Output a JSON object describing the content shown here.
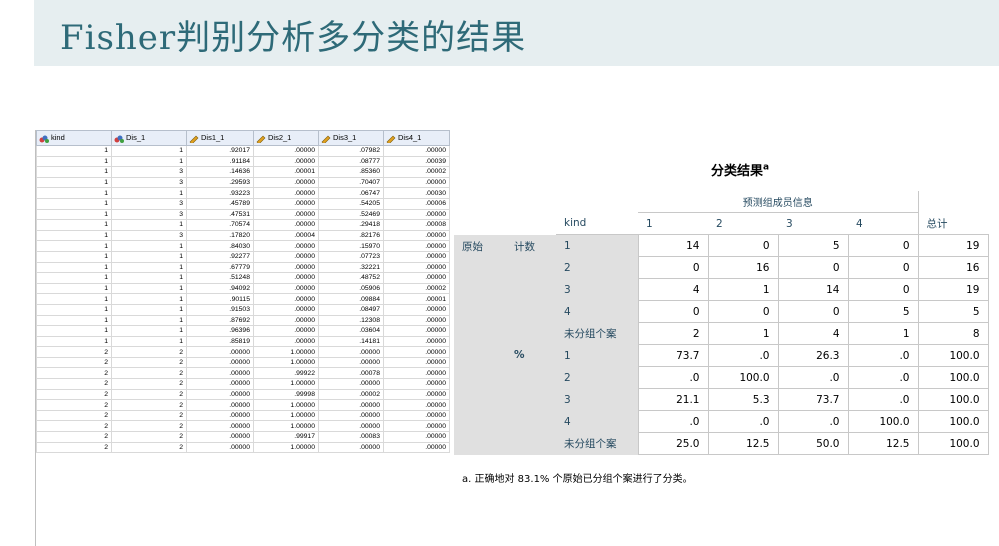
{
  "slide": {
    "title": "Fisher判别分析多分类的结果"
  },
  "grid": {
    "columns": [
      "kind",
      "Dis_1",
      "Dis1_1",
      "Dis2_1",
      "Dis3_1",
      "Dis4_1"
    ],
    "rows": [
      [
        "1",
        "1",
        ".92017",
        ".00000",
        ".07982",
        ".00000"
      ],
      [
        "1",
        "1",
        ".91184",
        ".00000",
        ".08777",
        ".00039"
      ],
      [
        "1",
        "3",
        ".14636",
        ".00001",
        ".85360",
        ".00002"
      ],
      [
        "1",
        "3",
        ".29593",
        ".00000",
        ".70407",
        ".00000"
      ],
      [
        "1",
        "1",
        ".93223",
        ".00000",
        ".06747",
        ".00030"
      ],
      [
        "1",
        "3",
        ".45789",
        ".00000",
        ".54205",
        ".00006"
      ],
      [
        "1",
        "3",
        ".47531",
        ".00000",
        ".52469",
        ".00000"
      ],
      [
        "1",
        "1",
        ".70574",
        ".00000",
        ".29418",
        ".00008"
      ],
      [
        "1",
        "3",
        ".17820",
        ".00004",
        ".82176",
        ".00000"
      ],
      [
        "1",
        "1",
        ".84030",
        ".00000",
        ".15970",
        ".00000"
      ],
      [
        "1",
        "1",
        ".92277",
        ".00000",
        ".07723",
        ".00000"
      ],
      [
        "1",
        "1",
        ".67779",
        ".00000",
        ".32221",
        ".00000"
      ],
      [
        "1",
        "1",
        ".51248",
        ".00000",
        ".48752",
        ".00000"
      ],
      [
        "1",
        "1",
        ".94092",
        ".00000",
        ".05906",
        ".00002"
      ],
      [
        "1",
        "1",
        ".90115",
        ".00000",
        ".09884",
        ".00001"
      ],
      [
        "1",
        "1",
        ".91503",
        ".00000",
        ".08497",
        ".00000"
      ],
      [
        "1",
        "1",
        ".87692",
        ".00000",
        ".12308",
        ".00000"
      ],
      [
        "1",
        "1",
        ".96396",
        ".00000",
        ".03604",
        ".00000"
      ],
      [
        "1",
        "1",
        ".85819",
        ".00000",
        ".14181",
        ".00000"
      ],
      [
        "2",
        "2",
        ".00000",
        "1.00000",
        ".00000",
        ".00000"
      ],
      [
        "2",
        "2",
        ".00000",
        "1.00000",
        ".00000",
        ".00000"
      ],
      [
        "2",
        "2",
        ".00000",
        ".99922",
        ".00078",
        ".00000"
      ],
      [
        "2",
        "2",
        ".00000",
        "1.00000",
        ".00000",
        ".00000"
      ],
      [
        "2",
        "2",
        ".00000",
        ".99998",
        ".00002",
        ".00000"
      ],
      [
        "2",
        "2",
        ".00000",
        "1.00000",
        ".00000",
        ".00000"
      ],
      [
        "2",
        "2",
        ".00000",
        "1.00000",
        ".00000",
        ".00000"
      ],
      [
        "2",
        "2",
        ".00000",
        "1.00000",
        ".00000",
        ".00000"
      ],
      [
        "2",
        "2",
        ".00000",
        ".99917",
        ".00083",
        ".00000"
      ],
      [
        "2",
        "2",
        ".00000",
        "1.00000",
        ".00000",
        ".00000"
      ]
    ]
  },
  "results": {
    "title": "分类结果",
    "title_sup": "a",
    "group_header": "预测组成员信息",
    "kind_header": "kind",
    "col_headers": [
      "1",
      "2",
      "3",
      "4"
    ],
    "total_header": "总计",
    "section_label": "原始",
    "count_label": "计数",
    "pct_label": "%",
    "count_rows": [
      {
        "label": "1",
        "values": [
          "14",
          "0",
          "5",
          "0"
        ],
        "total": "19"
      },
      {
        "label": "2",
        "values": [
          "0",
          "16",
          "0",
          "0"
        ],
        "total": "16"
      },
      {
        "label": "3",
        "values": [
          "4",
          "1",
          "14",
          "0"
        ],
        "total": "19"
      },
      {
        "label": "4",
        "values": [
          "0",
          "0",
          "0",
          "5"
        ],
        "total": "5"
      },
      {
        "label": "未分组个案",
        "values": [
          "2",
          "1",
          "4",
          "1"
        ],
        "total": "8"
      }
    ],
    "pct_rows": [
      {
        "label": "1",
        "values": [
          "73.7",
          ".0",
          "26.3",
          ".0"
        ],
        "total": "100.0"
      },
      {
        "label": "2",
        "values": [
          ".0",
          "100.0",
          ".0",
          ".0"
        ],
        "total": "100.0"
      },
      {
        "label": "3",
        "values": [
          "21.1",
          "5.3",
          "73.7",
          ".0"
        ],
        "total": "100.0"
      },
      {
        "label": "4",
        "values": [
          ".0",
          ".0",
          ".0",
          "100.0"
        ],
        "total": "100.0"
      },
      {
        "label": "未分组个案",
        "values": [
          "25.0",
          "12.5",
          "50.0",
          "12.5"
        ],
        "total": "100.0"
      }
    ],
    "footnote": "a. 正确地对 83.1% 个原始已分组个案进行了分类。"
  }
}
